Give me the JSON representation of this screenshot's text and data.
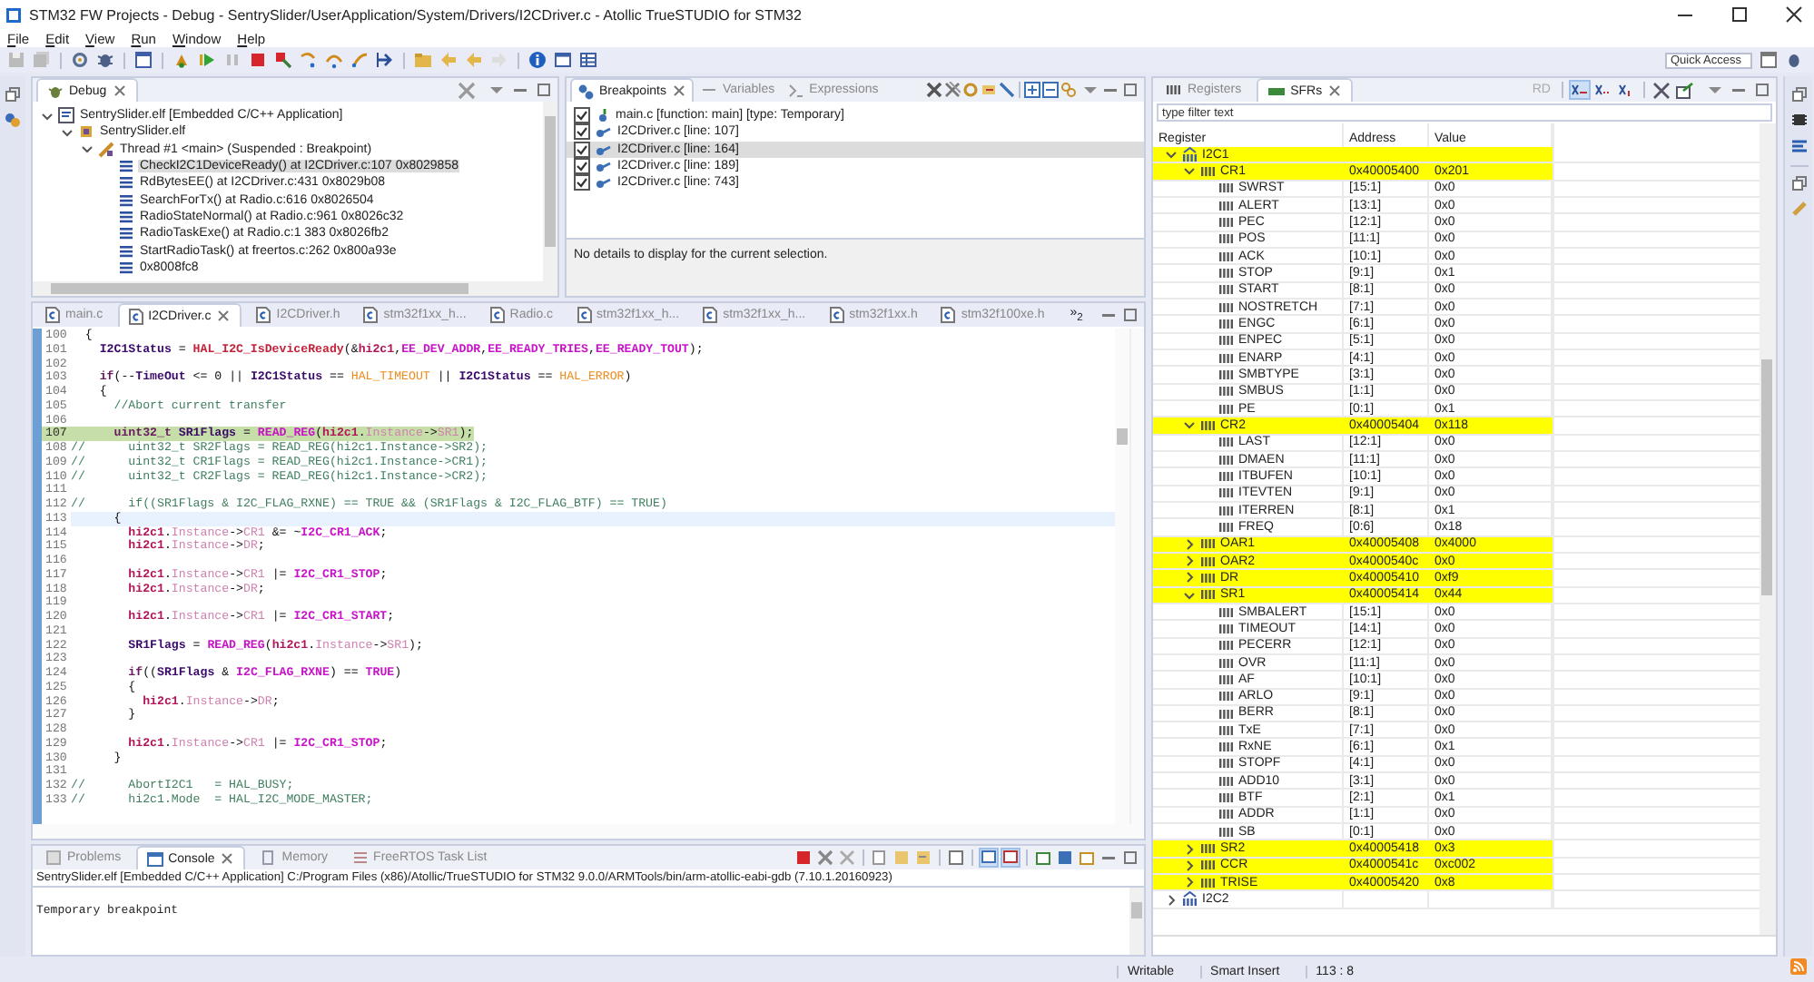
{
  "window": {
    "title": "STM32 FW Projects - Debug - SentrySlider/UserApplication/System/Drivers/I2CDriver.c - Atollic TrueSTUDIO for STM32"
  },
  "menu": [
    "File",
    "Edit",
    "View",
    "Run",
    "Window",
    "Help"
  ],
  "toolbar": {
    "quick_access": {
      "placeholder": "Quick Access"
    }
  },
  "debug_view": {
    "tabs": [
      {
        "label": "Debug",
        "selected": true
      }
    ],
    "tree": [
      {
        "label": "SentrySlider.elf [Embedded C/C++ Application]",
        "kind": "launch",
        "expanded": true,
        "selected": false,
        "children": [
          {
            "label": "SentrySlider.elf",
            "kind": "process",
            "expanded": true,
            "selected": false,
            "children": [
              {
                "label": "Thread #1 <main> (Suspended : Breakpoint)",
                "kind": "thread",
                "expanded": true,
                "selected": false,
                "children": [
                  {
                    "label": "CheckI2C1DeviceReady() at I2CDriver.c:107 0x8029858",
                    "kind": "frame",
                    "selected": true
                  },
                  {
                    "label": "RdBytesEE() at I2CDriver.c:431 0x8029b08",
                    "kind": "frame",
                    "selected": false
                  },
                  {
                    "label": "SearchForTx() at Radio.c:616 0x8026504",
                    "kind": "frame",
                    "selected": false
                  },
                  {
                    "label": "RadioStateNormal() at Radio.c:961 0x8026c32",
                    "kind": "frame",
                    "selected": false
                  },
                  {
                    "label": "RadioTaskExe() at Radio.c:1 383 0x8026fb2",
                    "kind": "frame",
                    "selected": false
                  },
                  {
                    "label": "StartRadioTask() at freertos.c:262 0x800a93e",
                    "kind": "frame",
                    "selected": false
                  },
                  {
                    "label": "0x8008fc8",
                    "kind": "frame",
                    "selected": false
                  }
                ]
              }
            ]
          }
        ]
      }
    ]
  },
  "breakpoints_view": {
    "tabs": [
      {
        "label": "Breakpoints",
        "selected": true
      },
      {
        "label": "Variables",
        "selected": false
      },
      {
        "label": "Expressions",
        "selected": false
      }
    ],
    "items": [
      {
        "label": "main.c [function: main] [type: Temporary]",
        "kind": "function",
        "checked": true,
        "selected": false
      },
      {
        "label": "I2CDriver.c [line: 107]",
        "kind": "line",
        "checked": true,
        "selected": false
      },
      {
        "label": "I2CDriver.c [line: 164]",
        "kind": "line",
        "checked": true,
        "selected": true
      },
      {
        "label": "I2CDriver.c [line: 189]",
        "kind": "line",
        "checked": true,
        "selected": false
      },
      {
        "label": "I2CDriver.c [line: 743]",
        "kind": "line",
        "checked": true,
        "selected": false
      }
    ],
    "details": "No details to display for the current selection."
  },
  "editor": {
    "tabs": [
      {
        "label": "main.c",
        "selected": false
      },
      {
        "label": "I2CDriver.c",
        "selected": true
      },
      {
        "label": "I2CDriver.h",
        "selected": false
      },
      {
        "label": "stm32f1xx_h...",
        "selected": false
      },
      {
        "label": "Radio.c",
        "selected": false
      },
      {
        "label": "stm32f1xx_h...",
        "selected": false
      },
      {
        "label": "stm32f1xx_h...",
        "selected": false
      },
      {
        "label": "stm32f1xx.h",
        "selected": false
      },
      {
        "label": "stm32f100xe.h",
        "selected": false
      }
    ],
    "overflow": "»$_{2}$",
    "lines": [
      {
        "number": "100",
        "current": false,
        "cursor": false,
        "tokens": [
          {
            "kind": "plain",
            "text": "  {"
          }
        ]
      },
      {
        "number": "101",
        "current": false,
        "cursor": false,
        "tokens": [
          {
            "kind": "var",
            "text": "    I2C1Status"
          },
          {
            "kind": "plain",
            "text": " = "
          },
          {
            "kind": "func",
            "text": "HAL_I2C_IsDeviceReady"
          },
          {
            "kind": "plain",
            "text": "(&"
          },
          {
            "kind": "obj",
            "text": "hi2c1"
          },
          {
            "kind": "plain",
            "text": ","
          },
          {
            "kind": "macro",
            "text": "EE_DEV_ADDR"
          },
          {
            "kind": "plain",
            "text": ","
          },
          {
            "kind": "macro",
            "text": "EE_READY_TRIES"
          },
          {
            "kind": "plain",
            "text": ","
          },
          {
            "kind": "macro",
            "text": "EE_READY_TOUT"
          },
          {
            "kind": "plain",
            "text": ");"
          }
        ]
      },
      {
        "number": "102",
        "current": false,
        "cursor": false
      },
      {
        "number": "103",
        "current": false,
        "cursor": false,
        "tokens": [
          {
            "kind": "keyword",
            "text": "    if"
          },
          {
            "kind": "plain",
            "text": "(--"
          },
          {
            "kind": "var",
            "text": "TimeOut"
          },
          {
            "kind": "plain",
            "text": " <= 0 || "
          },
          {
            "kind": "var",
            "text": "I2C1Status"
          },
          {
            "kind": "plain",
            "text": " == "
          },
          {
            "kind": "enum",
            "text": "HAL_TIMEOUT"
          },
          {
            "kind": "plain",
            "text": " || "
          },
          {
            "kind": "var",
            "text": "I2C1Status"
          },
          {
            "kind": "plain",
            "text": " == "
          },
          {
            "kind": "enum",
            "text": "HAL_ERROR"
          },
          {
            "kind": "plain",
            "text": ")"
          }
        ]
      },
      {
        "number": "104",
        "current": false,
        "cursor": false,
        "tokens": [
          {
            "kind": "plain",
            "text": "    {"
          }
        ]
      },
      {
        "number": "105",
        "current": false,
        "cursor": false,
        "tokens": [
          {
            "kind": "comment",
            "text": "      //Abort current transfer"
          }
        ]
      },
      {
        "number": "106",
        "current": false,
        "cursor": false
      },
      {
        "number": "107",
        "current": true,
        "cursor": false,
        "tokens": [
          {
            "kind": "keyword",
            "text": "      uint32_t"
          },
          {
            "kind": "var",
            "text": " SR1Flags"
          },
          {
            "kind": "plain",
            "text": " = "
          },
          {
            "kind": "macro",
            "text": "READ_REG"
          },
          {
            "kind": "plain",
            "text": "("
          },
          {
            "kind": "obj",
            "text": "hi2c1"
          },
          {
            "kind": "plain",
            "text": "."
          },
          {
            "kind": "field",
            "text": "Instance"
          },
          {
            "kind": "plain",
            "text": "->"
          },
          {
            "kind": "field",
            "text": "SR1"
          },
          {
            "kind": "plain",
            "text": ");"
          }
        ]
      },
      {
        "number": "108",
        "current": false,
        "cursor": false,
        "tokens": [
          {
            "kind": "comment",
            "text": "//      uint32_t SR2Flags = READ_REG(hi2c1.Instance->SR2);"
          }
        ]
      },
      {
        "number": "109",
        "current": false,
        "cursor": false,
        "tokens": [
          {
            "kind": "comment",
            "text": "//      uint32_t CR1Flags = READ_REG(hi2c1.Instance->CR1);"
          }
        ]
      },
      {
        "number": "110",
        "current": false,
        "cursor": false,
        "tokens": [
          {
            "kind": "comment",
            "text": "//      uint32_t CR2Flags = READ_REG(hi2c1.Instance->CR2);"
          }
        ]
      },
      {
        "number": "111",
        "current": false,
        "cursor": false
      },
      {
        "number": "112",
        "current": false,
        "cursor": false,
        "tokens": [
          {
            "kind": "comment",
            "text": "//      if((SR1Flags & I2C_FLAG_RXNE) == TRUE && (SR1Flags & I2C_FLAG_BTF) == TRUE)"
          }
        ]
      },
      {
        "number": "113",
        "current": false,
        "cursor": true,
        "tokens": [
          {
            "kind": "plain",
            "text": "      {"
          }
        ]
      },
      {
        "number": "114",
        "current": false,
        "cursor": false,
        "tokens": [
          {
            "kind": "obj",
            "text": "        hi2c1"
          },
          {
            "kind": "plain",
            "text": "."
          },
          {
            "kind": "field",
            "text": "Instance"
          },
          {
            "kind": "plain",
            "text": "->"
          },
          {
            "kind": "field",
            "text": "CR1"
          },
          {
            "kind": "plain",
            "text": " &= ~"
          },
          {
            "kind": "macro",
            "text": "I2C_CR1_ACK"
          },
          {
            "kind": "plain",
            "text": ";"
          }
        ]
      },
      {
        "number": "115",
        "current": false,
        "cursor": false,
        "tokens": [
          {
            "kind": "obj",
            "text": "        hi2c1"
          },
          {
            "kind": "plain",
            "text": "."
          },
          {
            "kind": "field",
            "text": "Instance"
          },
          {
            "kind": "plain",
            "text": "->"
          },
          {
            "kind": "field",
            "text": "DR"
          },
          {
            "kind": "plain",
            "text": ";"
          }
        ]
      },
      {
        "number": "116",
        "current": false,
        "cursor": false
      },
      {
        "number": "117",
        "current": false,
        "cursor": false,
        "tokens": [
          {
            "kind": "obj",
            "text": "        hi2c1"
          },
          {
            "kind": "plain",
            "text": "."
          },
          {
            "kind": "field",
            "text": "Instance"
          },
          {
            "kind": "plain",
            "text": "->"
          },
          {
            "kind": "field",
            "text": "CR1"
          },
          {
            "kind": "plain",
            "text": " |= "
          },
          {
            "kind": "macro",
            "text": "I2C_CR1_STOP"
          },
          {
            "kind": "plain",
            "text": ";"
          }
        ]
      },
      {
        "number": "118",
        "current": false,
        "cursor": false,
        "tokens": [
          {
            "kind": "obj",
            "text": "        hi2c1"
          },
          {
            "kind": "plain",
            "text": "."
          },
          {
            "kind": "field",
            "text": "Instance"
          },
          {
            "kind": "plain",
            "text": "->"
          },
          {
            "kind": "field",
            "text": "DR"
          },
          {
            "kind": "plain",
            "text": ";"
          }
        ]
      },
      {
        "number": "119",
        "current": false,
        "cursor": false
      },
      {
        "number": "120",
        "current": false,
        "cursor": false,
        "tokens": [
          {
            "kind": "obj",
            "text": "        hi2c1"
          },
          {
            "kind": "plain",
            "text": "."
          },
          {
            "kind": "field",
            "text": "Instance"
          },
          {
            "kind": "plain",
            "text": "->"
          },
          {
            "kind": "field",
            "text": "CR1"
          },
          {
            "kind": "plain",
            "text": " |= "
          },
          {
            "kind": "macro",
            "text": "I2C_CR1_START"
          },
          {
            "kind": "plain",
            "text": ";"
          }
        ]
      },
      {
        "number": "121",
        "current": false,
        "cursor": false
      },
      {
        "number": "122",
        "current": false,
        "cursor": false,
        "tokens": [
          {
            "kind": "var",
            "text": "        SR1Flags"
          },
          {
            "kind": "plain",
            "text": " = "
          },
          {
            "kind": "macro",
            "text": "READ_REG"
          },
          {
            "kind": "plain",
            "text": "("
          },
          {
            "kind": "obj",
            "text": "hi2c1"
          },
          {
            "kind": "plain",
            "text": "."
          },
          {
            "kind": "field",
            "text": "Instance"
          },
          {
            "kind": "plain",
            "text": "->"
          },
          {
            "kind": "field",
            "text": "SR1"
          },
          {
            "kind": "plain",
            "text": ");"
          }
        ]
      },
      {
        "number": "123",
        "current": false,
        "cursor": false
      },
      {
        "number": "124",
        "current": false,
        "cursor": false,
        "tokens": [
          {
            "kind": "keyword",
            "text": "        if"
          },
          {
            "kind": "plain",
            "text": "(("
          },
          {
            "kind": "var",
            "text": "SR1Flags"
          },
          {
            "kind": "plain",
            "text": " & "
          },
          {
            "kind": "macro",
            "text": "I2C_FLAG_RXNE"
          },
          {
            "kind": "plain",
            "text": ") == "
          },
          {
            "kind": "macro",
            "text": "TRUE"
          },
          {
            "kind": "plain",
            "text": ")"
          }
        ]
      },
      {
        "number": "125",
        "current": false,
        "cursor": false,
        "tokens": [
          {
            "kind": "plain",
            "text": "        {"
          }
        ]
      },
      {
        "number": "126",
        "current": false,
        "cursor": false,
        "tokens": [
          {
            "kind": "obj",
            "text": "          hi2c1"
          },
          {
            "kind": "plain",
            "text": "."
          },
          {
            "kind": "field",
            "text": "Instance"
          },
          {
            "kind": "plain",
            "text": "->"
          },
          {
            "kind": "field",
            "text": "DR"
          },
          {
            "kind": "plain",
            "text": ";"
          }
        ]
      },
      {
        "number": "127",
        "current": false,
        "cursor": false,
        "tokens": [
          {
            "kind": "plain",
            "text": "        }"
          }
        ]
      },
      {
        "number": "128",
        "current": false,
        "cursor": false
      },
      {
        "number": "129",
        "current": false,
        "cursor": false,
        "tokens": [
          {
            "kind": "obj",
            "text": "        hi2c1"
          },
          {
            "kind": "plain",
            "text": "."
          },
          {
            "kind": "field",
            "text": "Instance"
          },
          {
            "kind": "plain",
            "text": "->"
          },
          {
            "kind": "field",
            "text": "CR1"
          },
          {
            "kind": "plain",
            "text": " |= "
          },
          {
            "kind": "macro",
            "text": "I2C_CR1_STOP"
          },
          {
            "kind": "plain",
            "text": ";"
          }
        ]
      },
      {
        "number": "130",
        "current": false,
        "cursor": false,
        "tokens": [
          {
            "kind": "plain",
            "text": "      }"
          }
        ]
      },
      {
        "number": "131",
        "current": false,
        "cursor": false
      },
      {
        "number": "132",
        "current": false,
        "cursor": false,
        "tokens": [
          {
            "kind": "comment",
            "text": "//      AbortI2C1   = HAL_BUSY;"
          }
        ]
      },
      {
        "number": "133",
        "current": false,
        "cursor": false,
        "tokens": [
          {
            "kind": "comment",
            "text": "//      hi2c1.Mode  = HAL_I2C_MODE_MASTER;"
          }
        ]
      }
    ]
  },
  "console_view": {
    "tabs": [
      {
        "label": "Problems",
        "selected": false
      },
      {
        "label": "Console",
        "selected": true
      },
      {
        "label": "Memory",
        "selected": false
      },
      {
        "label": "FreeRTOS Task List",
        "selected": false
      }
    ],
    "header": "SentrySlider.elf [Embedded C/C++ Application] C:/Program Files (x86)/Atollic/TrueSTUDIO for STM32 9.0.0/ARMTools/bin/arm-atollic-eabi-gdb (7.10.1.20160923)",
    "lines": [
      "Temporary breakpoint"
    ]
  },
  "sfr_view": {
    "tabs": [
      {
        "label": "Registers",
        "selected": false
      },
      {
        "label": "SFRs",
        "selected": true
      }
    ],
    "rd_label": "RD",
    "filter": {
      "placeholder": "type filter text"
    },
    "columns": [
      "Register",
      "Address",
      "Value"
    ],
    "rows": [
      {
        "name": "I2C1",
        "kind": "peripheral",
        "expanded": true,
        "highlighted": true,
        "children": [
          {
            "name": "CR1",
            "kind": "register",
            "address": "0x40005400",
            "value": "0x201",
            "expanded": true,
            "highlighted": true,
            "children": [
              {
                "name": "SWRST",
                "kind": "field",
                "address": "[15:1]",
                "value": "0x0",
                "highlighted": false
              },
              {
                "name": "ALERT",
                "kind": "field",
                "address": "[13:1]",
                "value": "0x0",
                "highlighted": false
              },
              {
                "name": "PEC",
                "kind": "field",
                "address": "[12:1]",
                "value": "0x0",
                "highlighted": false
              },
              {
                "name": "POS",
                "kind": "field",
                "address": "[11:1]",
                "value": "0x0",
                "highlighted": false
              },
              {
                "name": "ACK",
                "kind": "field",
                "address": "[10:1]",
                "value": "0x0",
                "highlighted": false
              },
              {
                "name": "STOP",
                "kind": "field",
                "address": "[9:1]",
                "value": "0x1",
                "highlighted": false
              },
              {
                "name": "START",
                "kind": "field",
                "address": "[8:1]",
                "value": "0x0",
                "highlighted": false
              },
              {
                "name": "NOSTRETCH",
                "kind": "field",
                "address": "[7:1]",
                "value": "0x0",
                "highlighted": false
              },
              {
                "name": "ENGC",
                "kind": "field",
                "address": "[6:1]",
                "value": "0x0",
                "highlighted": false
              },
              {
                "name": "ENPEC",
                "kind": "field",
                "address": "[5:1]",
                "value": "0x0",
                "highlighted": false
              },
              {
                "name": "ENARP",
                "kind": "field",
                "address": "[4:1]",
                "value": "0x0",
                "highlighted": false
              },
              {
                "name": "SMBTYPE",
                "kind": "field",
                "address": "[3:1]",
                "value": "0x0",
                "highlighted": false
              },
              {
                "name": "SMBUS",
                "kind": "field",
                "address": "[1:1]",
                "value": "0x0",
                "highlighted": false
              },
              {
                "name": "PE",
                "kind": "field",
                "address": "[0:1]",
                "value": "0x1",
                "highlighted": false
              }
            ]
          },
          {
            "name": "CR2",
            "kind": "register",
            "address": "0x40005404",
            "value": "0x118",
            "expanded": true,
            "highlighted": true,
            "children": [
              {
                "name": "LAST",
                "kind": "field",
                "address": "[12:1]",
                "value": "0x0",
                "highlighted": false
              },
              {
                "name": "DMAEN",
                "kind": "field",
                "address": "[11:1]",
                "value": "0x0",
                "highlighted": false
              },
              {
                "name": "ITBUFEN",
                "kind": "field",
                "address": "[10:1]",
                "value": "0x0",
                "highlighted": false
              },
              {
                "name": "ITEVTEN",
                "kind": "field",
                "address": "[9:1]",
                "value": "0x0",
                "highlighted": false
              },
              {
                "name": "ITERREN",
                "kind": "field",
                "address": "[8:1]",
                "value": "0x1",
                "highlighted": false
              },
              {
                "name": "FREQ",
                "kind": "field",
                "address": "[0:6]",
                "value": "0x18",
                "highlighted": false
              }
            ]
          },
          {
            "name": "OAR1",
            "kind": "register",
            "address": "0x40005408",
            "value": "0x4000",
            "expanded": false,
            "highlighted": true
          },
          {
            "name": "OAR2",
            "kind": "register",
            "address": "0x4000540c",
            "value": "0x0",
            "expanded": false,
            "highlighted": true
          },
          {
            "name": "DR",
            "kind": "register",
            "address": "0x40005410",
            "value": "0xf9",
            "expanded": false,
            "highlighted": true
          },
          {
            "name": "SR1",
            "kind": "register",
            "address": "0x40005414",
            "value": "0x44",
            "expanded": true,
            "highlighted": true,
            "children": [
              {
                "name": "SMBALERT",
                "kind": "field",
                "address": "[15:1]",
                "value": "0x0",
                "highlighted": false
              },
              {
                "name": "TIMEOUT",
                "kind": "field",
                "address": "[14:1]",
                "value": "0x0",
                "highlighted": false
              },
              {
                "name": "PECERR",
                "kind": "field",
                "address": "[12:1]",
                "value": "0x0",
                "highlighted": false
              },
              {
                "name": "OVR",
                "kind": "field",
                "address": "[11:1]",
                "value": "0x0",
                "highlighted": false
              },
              {
                "name": "AF",
                "kind": "field",
                "address": "[10:1]",
                "value": "0x0",
                "highlighted": false
              },
              {
                "name": "ARLO",
                "kind": "field",
                "address": "[9:1]",
                "value": "0x0",
                "highlighted": false
              },
              {
                "name": "BERR",
                "kind": "field",
                "address": "[8:1]",
                "value": "0x0",
                "highlighted": false
              },
              {
                "name": "TxE",
                "kind": "field",
                "address": "[7:1]",
                "value": "0x0",
                "highlighted": false
              },
              {
                "name": "RxNE",
                "kind": "field",
                "address": "[6:1]",
                "value": "0x1",
                "highlighted": false
              },
              {
                "name": "STOPF",
                "kind": "field",
                "address": "[4:1]",
                "value": "0x0",
                "highlighted": false
              },
              {
                "name": "ADD10",
                "kind": "field",
                "address": "[3:1]",
                "value": "0x0",
                "highlighted": false
              },
              {
                "name": "BTF",
                "kind": "field",
                "address": "[2:1]",
                "value": "0x1",
                "highlighted": false
              },
              {
                "name": "ADDR",
                "kind": "field",
                "address": "[1:1]",
                "value": "0x0",
                "highlighted": false
              },
              {
                "name": "SB",
                "kind": "field",
                "address": "[0:1]",
                "value": "0x0",
                "highlighted": false
              }
            ]
          },
          {
            "name": "SR2",
            "kind": "register",
            "address": "0x40005418",
            "value": "0x3",
            "expanded": false,
            "highlighted": true
          },
          {
            "name": "CCR",
            "kind": "register",
            "address": "0x4000541c",
            "value": "0xc002",
            "expanded": false,
            "highlighted": true
          },
          {
            "name": "TRISE",
            "kind": "register",
            "address": "0x40005420",
            "value": "0x8",
            "expanded": false,
            "highlighted": true
          }
        ]
      },
      {
        "name": "I2C2",
        "kind": "peripheral",
        "expanded": false,
        "highlighted": false
      }
    ]
  },
  "status_bar": [
    "Writable",
    "Smart Insert",
    "113 : 8"
  ]
}
